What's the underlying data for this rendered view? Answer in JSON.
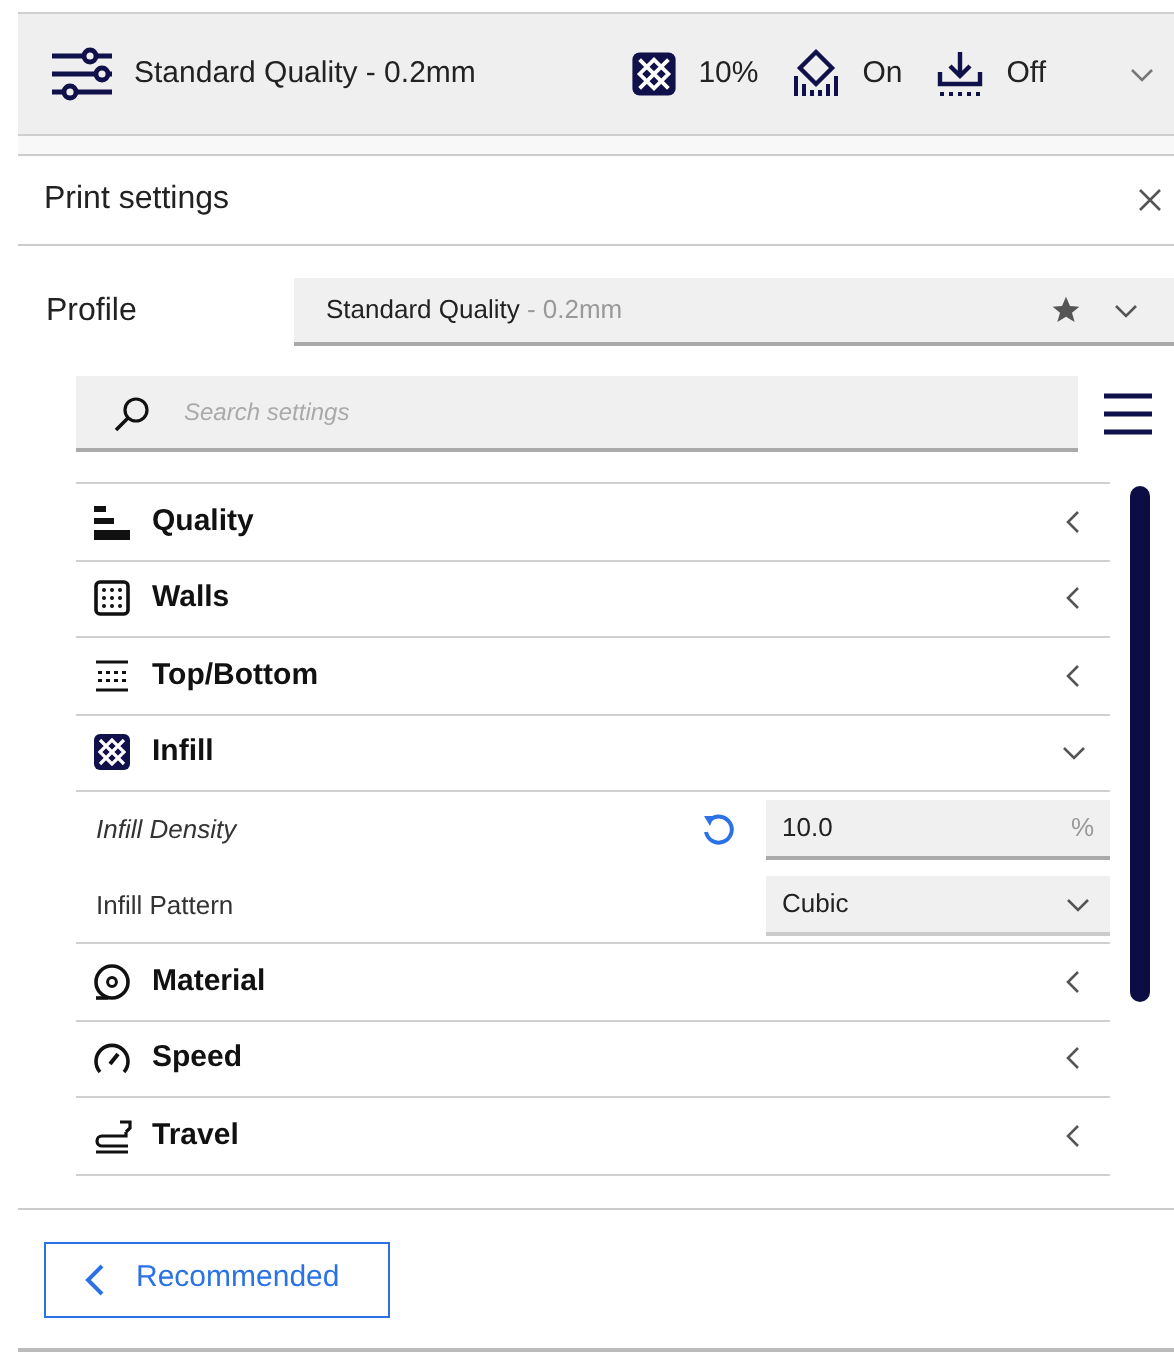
{
  "header": {
    "profile": "Standard Quality - 0.2mm",
    "infill": "10%",
    "support": "On",
    "adhesion": "Off"
  },
  "panel": {
    "title": "Print settings"
  },
  "profile": {
    "label": "Profile",
    "name": "Standard Quality",
    "detail": "- 0.2mm"
  },
  "search": {
    "placeholder": "Search settings"
  },
  "settings": [
    {
      "kind": "category",
      "label": "Quality",
      "expanded": false
    },
    {
      "kind": "category",
      "label": "Walls",
      "expanded": false
    },
    {
      "kind": "category",
      "label": "Top/Bottom",
      "expanded": false
    },
    {
      "kind": "category",
      "label": "Infill",
      "expanded": true
    },
    {
      "kind": "number",
      "label": "Infill Density",
      "modified": true,
      "value": "10.0",
      "unit": "%"
    },
    {
      "kind": "select",
      "label": "Infill Pattern",
      "modified": false,
      "value": "Cubic"
    },
    {
      "kind": "category",
      "label": "Material",
      "expanded": false
    },
    {
      "kind": "category",
      "label": "Speed",
      "expanded": false
    },
    {
      "kind": "category",
      "label": "Travel",
      "expanded": false
    }
  ],
  "footer": {
    "button": "Recommended"
  }
}
